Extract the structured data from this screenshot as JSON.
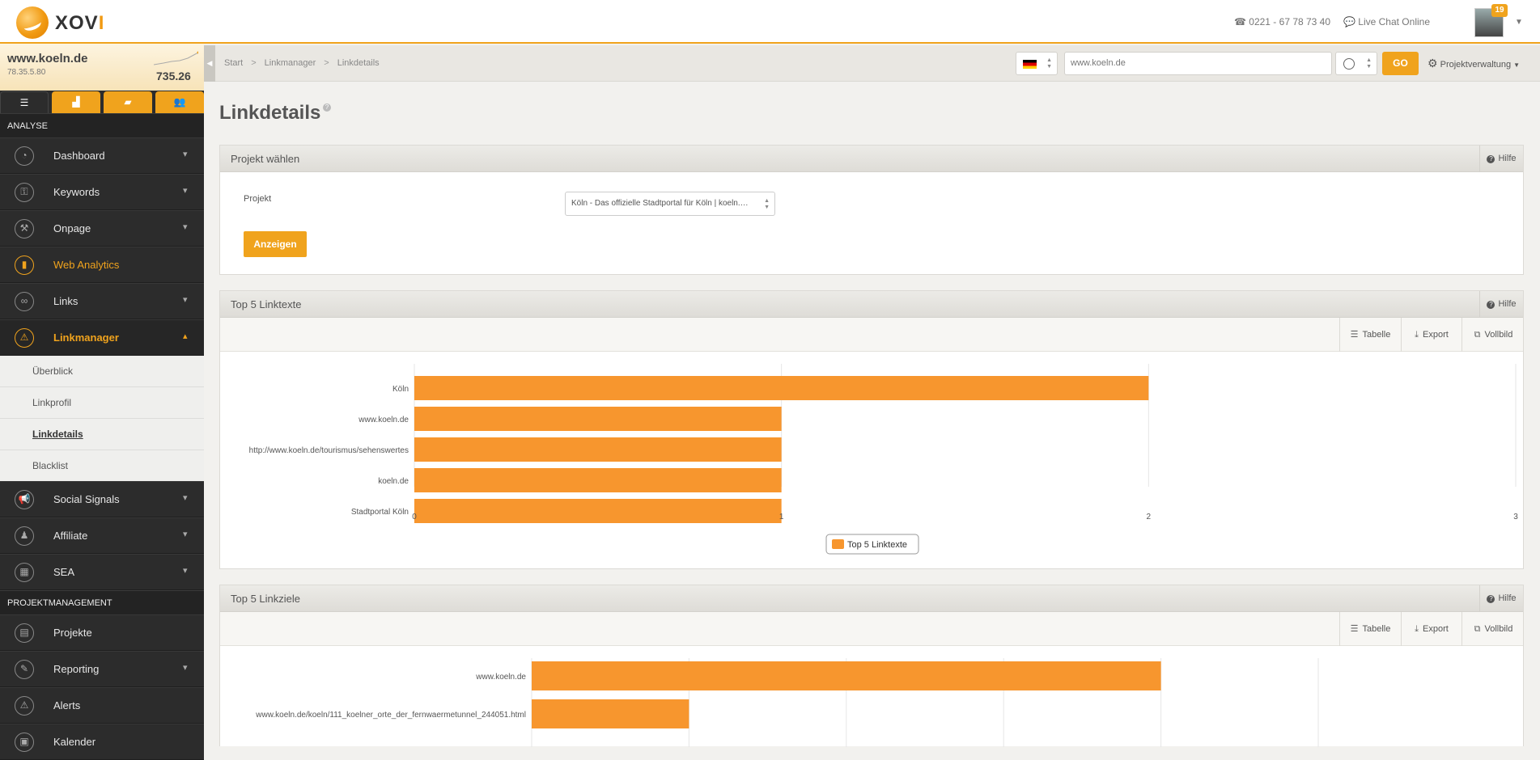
{
  "app": {
    "logo_text_main": "XOV",
    "logo_text_accent": "I",
    "phone": "0221 - 67 78 73 40",
    "live_chat": "Live Chat Online",
    "notification_count": "19"
  },
  "domain": {
    "name": "www.koeln.de",
    "ip": "78.35.5.80",
    "score": "735.26"
  },
  "sidebar": {
    "sections": [
      {
        "title": "ANALYSE"
      },
      {
        "title": "PROJEKTMANAGEMENT"
      }
    ],
    "items": [
      {
        "label": "Dashboard",
        "icon": "gauge-icon"
      },
      {
        "label": "Keywords",
        "icon": "key-icon"
      },
      {
        "label": "Onpage",
        "icon": "wrench-icon"
      },
      {
        "label": "Web Analytics",
        "icon": "bar-chart-icon"
      },
      {
        "label": "Links",
        "icon": "link-icon"
      },
      {
        "label": "Linkmanager",
        "icon": "linkmanager-icon"
      },
      {
        "label": "Social Signals",
        "icon": "megaphone-icon"
      },
      {
        "label": "Affiliate",
        "icon": "people-icon"
      },
      {
        "label": "SEA",
        "icon": "sign-icon"
      },
      {
        "label": "Projekte",
        "icon": "clipboard-icon"
      },
      {
        "label": "Reporting",
        "icon": "report-icon"
      },
      {
        "label": "Alerts",
        "icon": "warning-icon"
      },
      {
        "label": "Kalender",
        "icon": "calendar-icon"
      }
    ],
    "subitems": [
      {
        "label": "Überblick"
      },
      {
        "label": "Linkprofil"
      },
      {
        "label": "Linkdetails"
      },
      {
        "label": "Blacklist"
      }
    ]
  },
  "breadcrumb": [
    "Start",
    "Linkmanager",
    "Linkdetails"
  ],
  "toolbar": {
    "url_value": "www.koeln.de",
    "go_label": "GO",
    "projekt_menu": "Projektverwaltung"
  },
  "page": {
    "title": "Linkdetails"
  },
  "panel_projekt": {
    "title": "Projekt wählen",
    "help": "Hilfe",
    "label": "Projekt",
    "select_value": "Köln - Das offizielle Stadtportal für Köln | koeln.…",
    "button": "Anzeigen"
  },
  "tools": {
    "table": "Tabelle",
    "export": "Export",
    "fullscreen": "Vollbild"
  },
  "colors": {
    "accent": "#f0a31d",
    "bar": "#f7962e"
  },
  "chart_data": [
    {
      "type": "bar",
      "orientation": "horizontal",
      "title": "Top 5 Linktexte",
      "categories": [
        "Köln",
        "www.koeln.de",
        "http://www.koeln.de/tourismus/sehenswertes",
        "koeln.de",
        "Stadtportal Köln"
      ],
      "series": [
        {
          "name": "Top 5 Linktexte",
          "values": [
            2,
            1,
            1,
            1,
            1
          ]
        }
      ],
      "xlim": [
        0,
        3
      ],
      "ticks": [
        "0",
        "1",
        "2",
        "3"
      ],
      "legend": "bottom-center",
      "grid": true
    },
    {
      "type": "bar",
      "orientation": "horizontal",
      "title": "Top 5 Linkziele",
      "categories": [
        "www.koeln.de",
        "www.koeln.de/koeln/111_koelner_orte_der_fernwaermetunnel_244051.html"
      ],
      "series": [
        {
          "values": [
            4,
            1
          ]
        }
      ],
      "xlim": [
        0,
        5
      ],
      "grid": true
    }
  ]
}
